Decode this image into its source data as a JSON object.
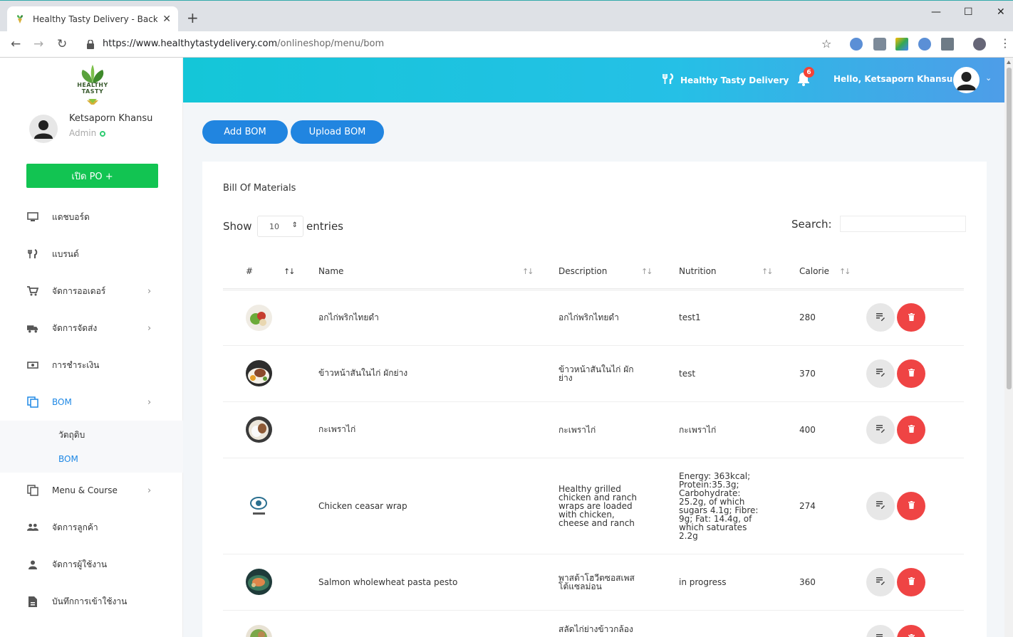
{
  "browser": {
    "tab_title": "Healthy Tasty Delivery - Backend",
    "url_host": "https://www.healthytastydelivery.com",
    "url_path": "/onlineshop/menu/bom"
  },
  "sidebar": {
    "logo_text_1": "HEALTHY",
    "logo_text_2": "TASTY",
    "user_name": "Ketsaporn Khansu",
    "user_role": "Admin",
    "po_button": "เปิด PO +",
    "items": [
      {
        "label": "แดชบอร์ด",
        "icon": "monitor-icon"
      },
      {
        "label": "แบรนด์",
        "icon": "fork-knife-icon"
      },
      {
        "label": "จัดการออเดอร์",
        "icon": "cart-icon"
      },
      {
        "label": "จัดการจัดส่ง",
        "icon": "truck-icon"
      },
      {
        "label": "การชำระเงิน",
        "icon": "money-icon"
      },
      {
        "label": "BOM",
        "icon": "copy-icon"
      },
      {
        "label": "Menu & Course",
        "icon": "copy-icon"
      },
      {
        "label": "จัดการลูกค้า",
        "icon": "people-icon"
      },
      {
        "label": "จัดการผู้ใช้งาน",
        "icon": "person-icon"
      },
      {
        "label": "บันทึกการเข้าใช้งาน",
        "icon": "log-icon"
      }
    ],
    "submenu": [
      {
        "label": "วัตถุดิบ"
      },
      {
        "label": "BOM"
      }
    ]
  },
  "header": {
    "brand": "Healthy Tasty Delivery",
    "notifications": "6",
    "greeting": "Hello, Ketsaporn Khansu !"
  },
  "toolbar": {
    "add_bom": "Add BOM",
    "upload_bom": "Upload BOM"
  },
  "card": {
    "title": "Bill Of Materials",
    "show_label": "Show",
    "entries_value": "10",
    "entries_label": "entries",
    "search_label": "Search:"
  },
  "table": {
    "columns": [
      "#",
      "Name",
      "Description",
      "Nutrition",
      "Calorie"
    ],
    "rows": [
      {
        "name": "อกไก่พริกไทยดำ",
        "description": "อกไก่พริกไทยดำ",
        "nutrition": "test1",
        "calorie": "280"
      },
      {
        "name": "ข้าวหน้าสันในไก่ ผักย่าง",
        "description": "ข้าวหน้าสันในไก่ ผักย่าง",
        "nutrition": "test",
        "calorie": "370"
      },
      {
        "name": "กะเพราไก่",
        "description": "กะเพราไก่",
        "nutrition": "กะเพราไก่",
        "calorie": "400"
      },
      {
        "name": "Chicken ceasar wrap",
        "description": "Healthy grilled chicken and ranch wraps are loaded with chicken, cheese and ranch",
        "nutrition": "Energy: 363kcal; Protein:35.3g; Carbohydrate: 25.2g, of which sugars 4.1g; Fibre: 9g; Fat: 14.4g, of which saturates 2.2g",
        "calorie": "274"
      },
      {
        "name": "Salmon wholewheat pasta pesto",
        "description": "พาสต้าโฮวีตซอสเพสโต้แซลม่อน",
        "nutrition": "in progress",
        "calorie": "360"
      },
      {
        "name": "",
        "description": "สลัดไก่ย่างข้าวกล้อง",
        "nutrition": "",
        "calorie": ""
      }
    ]
  }
}
